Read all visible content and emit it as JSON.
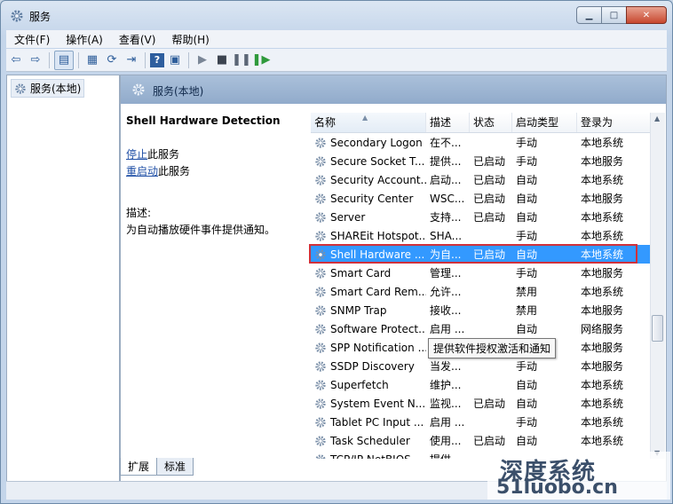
{
  "window": {
    "title": "服务"
  },
  "window_buttons": {
    "minimize": "▁",
    "maximize": "□",
    "close": "✕"
  },
  "menu": [
    "文件(F)",
    "操作(A)",
    "查看(V)",
    "帮助(H)"
  ],
  "tree": {
    "item": "服务(本地)"
  },
  "panel": {
    "header": "服务(本地)"
  },
  "details": {
    "service_name": "Shell Hardware Detection",
    "stop_link": "停止",
    "stop_suffix": "此服务",
    "restart_link": "重启动",
    "restart_suffix": "此服务",
    "desc_label": "描述:",
    "desc_text": "为自动播放硬件事件提供通知。"
  },
  "columns": [
    "名称",
    "描述",
    "状态",
    "启动类型",
    "登录为"
  ],
  "services": [
    {
      "name": "Secondary Logon",
      "desc": "在不...",
      "status": "",
      "start": "手动",
      "logon": "本地系统"
    },
    {
      "name": "Secure Socket T...",
      "desc": "提供...",
      "status": "已启动",
      "start": "手动",
      "logon": "本地服务"
    },
    {
      "name": "Security Account...",
      "desc": "启动...",
      "status": "已启动",
      "start": "自动",
      "logon": "本地系统"
    },
    {
      "name": "Security Center",
      "desc": "WSC...",
      "status": "已启动",
      "start": "自动",
      "logon": "本地服务"
    },
    {
      "name": "Server",
      "desc": "支持...",
      "status": "已启动",
      "start": "自动",
      "logon": "本地系统"
    },
    {
      "name": "SHAREit Hotspot...",
      "desc": "SHA...",
      "status": "",
      "start": "手动",
      "logon": "本地系统"
    },
    {
      "name": "Shell Hardware ...",
      "desc": "为自...",
      "status": "已启动",
      "start": "自动",
      "logon": "本地系统"
    },
    {
      "name": "Smart Card",
      "desc": "管理...",
      "status": "",
      "start": "手动",
      "logon": "本地服务"
    },
    {
      "name": "Smart Card Rem...",
      "desc": "允许...",
      "status": "",
      "start": "禁用",
      "logon": "本地系统"
    },
    {
      "name": "SNMP Trap",
      "desc": "接收...",
      "status": "",
      "start": "禁用",
      "logon": "本地服务"
    },
    {
      "name": "Software Protect...",
      "desc": "启用 ...",
      "status": "",
      "start": "自动",
      "logon": "网络服务"
    },
    {
      "name": "SPP Notification ...",
      "desc": "",
      "status": "",
      "start": "",
      "logon": "本地服务"
    },
    {
      "name": "SSDP Discovery",
      "desc": "当发...",
      "status": "",
      "start": "手动",
      "logon": "本地服务"
    },
    {
      "name": "Superfetch",
      "desc": "维护...",
      "status": "",
      "start": "自动",
      "logon": "本地系统"
    },
    {
      "name": "System Event N...",
      "desc": "监视...",
      "status": "已启动",
      "start": "自动",
      "logon": "本地系统"
    },
    {
      "name": "Tablet PC Input ...",
      "desc": "启用 ...",
      "status": "",
      "start": "手动",
      "logon": "本地系统"
    },
    {
      "name": "Task Scheduler",
      "desc": "使用...",
      "status": "已启动",
      "start": "自动",
      "logon": "本地系统"
    },
    {
      "name": "TCP/IP NetBIOS ...",
      "desc": "提供...",
      "status": "",
      "start": "",
      "logon": ""
    }
  ],
  "selected_index": 6,
  "tooltip": "提供软件授权激活和通知",
  "tabs": [
    "扩展",
    "标准"
  ],
  "watermark": {
    "line1": "深度系统",
    "line2": "51luobo.cn"
  },
  "colors": {
    "selection": "#3399ff",
    "highlight_frame": "#d0313b",
    "header_bg": "#91abcb"
  }
}
